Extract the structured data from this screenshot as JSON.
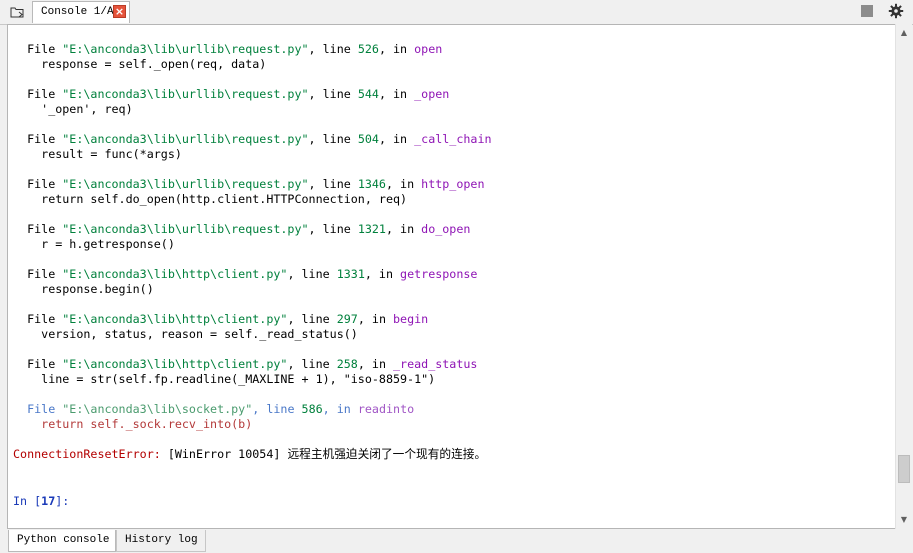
{
  "header": {
    "tab_label": "Console 1/A",
    "close_label": "×"
  },
  "console": {
    "traceback": [
      {
        "file": "\"E:\\anconda3\\lib\\urllib\\request.py\"",
        "line_no": "526",
        "func": "open",
        "code": "response = self._open(req, data)"
      },
      {
        "file": "\"E:\\anconda3\\lib\\urllib\\request.py\"",
        "line_no": "544",
        "func": "_open",
        "code": "'_open', req)"
      },
      {
        "file": "\"E:\\anconda3\\lib\\urllib\\request.py\"",
        "line_no": "504",
        "func": "_call_chain",
        "code": "result = func(*args)"
      },
      {
        "file": "\"E:\\anconda3\\lib\\urllib\\request.py\"",
        "line_no": "1346",
        "func": "http_open",
        "code": "return self.do_open(http.client.HTTPConnection, req)"
      },
      {
        "file": "\"E:\\anconda3\\lib\\urllib\\request.py\"",
        "line_no": "1321",
        "func": "do_open",
        "code": "r = h.getresponse()"
      },
      {
        "file": "\"E:\\anconda3\\lib\\http\\client.py\"",
        "line_no": "1331",
        "func": "getresponse",
        "code": "response.begin()"
      },
      {
        "file": "\"E:\\anconda3\\lib\\http\\client.py\"",
        "line_no": "297",
        "func": "begin",
        "code": "version, status, reason = self._read_status()"
      },
      {
        "file": "\"E:\\anconda3\\lib\\http\\client.py\"",
        "line_no": "258",
        "func": "_read_status",
        "code": "line = str(self.fp.readline(_MAXLINE + 1), \"iso-8859-1\")"
      },
      {
        "file": "\"E:\\anconda3\\lib\\socket.py\"",
        "line_no": "586",
        "func": "readinto",
        "code": "return self._sock.recv_into(b)"
      }
    ],
    "keywords": {
      "file": "File ",
      "line": ", line ",
      "in": ", in "
    },
    "error_type": "ConnectionResetError:",
    "error_message": " [WinError 10054] 远程主机强迫关闭了一个现有的连接。",
    "prompt_prefix": "In [",
    "prompt_number": "17",
    "prompt_suffix": "]:"
  },
  "scrollbar": {
    "up": "▲",
    "down": "▼"
  },
  "bottom_tabs": {
    "python_console": "Python console",
    "history_log": "History log"
  }
}
